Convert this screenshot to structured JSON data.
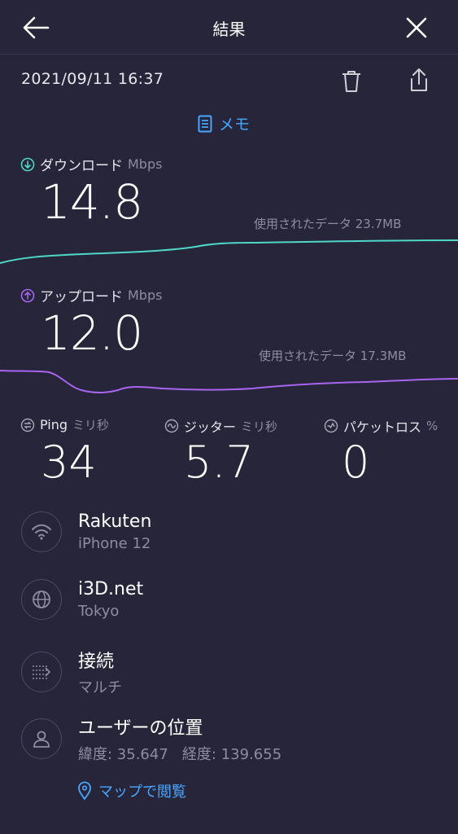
{
  "header": {
    "title": "結果"
  },
  "datetime": "2021/09/11 16:37",
  "memo_label": "メモ",
  "download": {
    "label": "ダウンロード",
    "unit": "Mbps",
    "value": "14.8",
    "data_used": "使用されたデータ 23.7MB",
    "color": "#4fd8c8"
  },
  "upload": {
    "label": "アップロード",
    "unit": "Mbps",
    "value": "12.0",
    "data_used": "使用されたデータ 17.3MB",
    "color": "#a866f0"
  },
  "ping": {
    "label": "Ping",
    "unit": "ミリ秒",
    "value": "34"
  },
  "jitter": {
    "label": "ジッター",
    "unit": "ミリ秒",
    "value": "5.7"
  },
  "packet_loss": {
    "label": "パケットロス",
    "unit": "%",
    "value": "0"
  },
  "provider": {
    "title": "Rakuten",
    "subtitle": "iPhone 12"
  },
  "server": {
    "title": "i3D.net",
    "subtitle": "Tokyo"
  },
  "connection": {
    "title": "接続",
    "subtitle": "マルチ"
  },
  "location": {
    "title": "ユーザーの位置",
    "subtitle": "緯度: 35.647   経度: 139.655"
  },
  "map_link": "マップで閲覧",
  "accent": "#49a6ff",
  "background": "#26253a"
}
